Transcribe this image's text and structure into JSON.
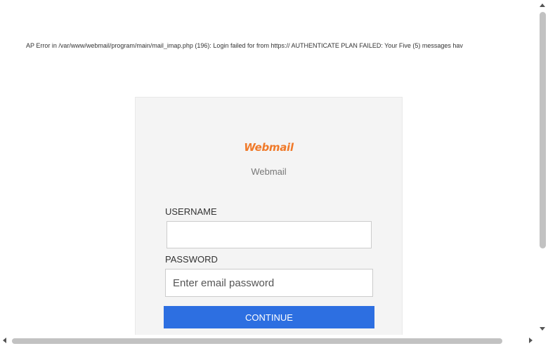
{
  "error": {
    "text": "AP Error in /var/www/webmail/program/main/mail_imap.php (196): Login failed for from https:// AUTHENTICATE PLAN FAILED: Your Five (5) messages hav"
  },
  "login": {
    "logo_text": "Webmail",
    "subtitle": "Webmail",
    "username_label": "USERNAME",
    "username_value": "",
    "password_label": "PASSWORD",
    "password_placeholder": "Enter email password",
    "continue_label": "CONTINUE"
  },
  "colors": {
    "accent": "#2d6fe1",
    "logo": "#f07a2a",
    "card_bg": "#f4f4f4"
  }
}
